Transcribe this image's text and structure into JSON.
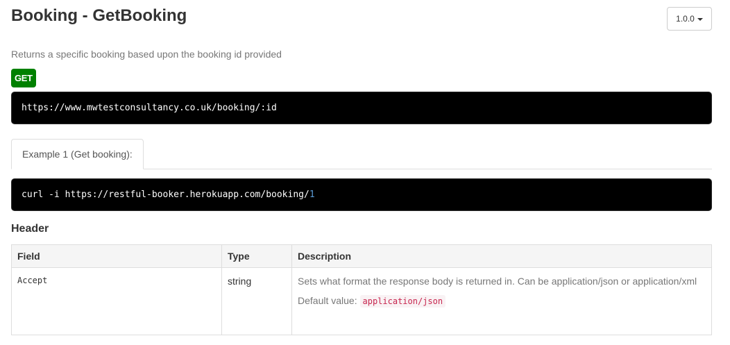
{
  "page": {
    "title": "Booking - GetBooking",
    "description": "Returns a specific booking based upon the booking id provided"
  },
  "version": {
    "selected": "1.0.0"
  },
  "endpoint": {
    "method": "GET",
    "method_color": "#008000",
    "url": "https://www.mwtestconsultancy.co.uk/booking/:id"
  },
  "examples": {
    "tabs": [
      {
        "label": "Example 1 (Get booking):"
      }
    ],
    "code_prefix": "curl -i https://restful-booker.herokuapp.com/booking/",
    "code_id": "1"
  },
  "header_section": {
    "heading": "Header",
    "columns": [
      "Field",
      "Type",
      "Description"
    ],
    "rows": [
      {
        "field": "Accept",
        "type": "string",
        "description": "Sets what format the response body is returned in. Can be application/json or application/xml",
        "default_label": "Default value:",
        "default_value": "application/json"
      }
    ]
  },
  "icons": {
    "caret": "chevron-down-icon"
  }
}
